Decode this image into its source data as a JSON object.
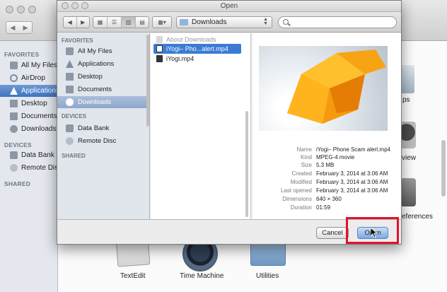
{
  "background": {
    "sidebar": {
      "favorites_header": "FAVORITES",
      "favorites": [
        "All My Files",
        "AirDrop",
        "Applications",
        "Desktop",
        "Documents",
        "Downloads"
      ],
      "selected": "Applications",
      "devices_header": "DEVICES",
      "devices": [
        "Data Bank",
        "Remote Disc"
      ],
      "shared_header": "SHARED"
    },
    "apps": [
      "TextEdit",
      "Time Machine",
      "Utilities"
    ],
    "right_labels": [
      "ps",
      "view",
      "eferences"
    ]
  },
  "dialog": {
    "title": "Open",
    "location": "Downloads",
    "search_placeholder": "",
    "sidebar": {
      "favorites_header": "FAVORITES",
      "favorites": [
        "All My Files",
        "Applications",
        "Desktop",
        "Documents",
        "Downloads"
      ],
      "selected": "Downloads",
      "devices_header": "DEVICES",
      "devices": [
        "Data Bank",
        "Remote Disc"
      ],
      "shared_header": "SHARED"
    },
    "files": [
      {
        "name": "About Downloads",
        "state": "dimmed"
      },
      {
        "name": "iYogi– Pho...alert.mp4",
        "state": "selected"
      },
      {
        "name": "iYogi.mp4",
        "state": "normal"
      }
    ],
    "preview": {
      "metadata": [
        {
          "key": "Name",
          "value": "iYogi– Phone Scam alert.mp4"
        },
        {
          "key": "Kind",
          "value": "MPEG-4 movie"
        },
        {
          "key": "Size",
          "value": "5.3 MB"
        },
        {
          "key": "Created",
          "value": "February 3, 2014 at 3:06 AM"
        },
        {
          "key": "Modified",
          "value": "February 3, 2014 at 3:06 AM"
        },
        {
          "key": "Last opened",
          "value": "February 3, 2014 at 3:06 AM"
        },
        {
          "key": "Dimensions",
          "value": "640 × 360"
        },
        {
          "key": "Duration",
          "value": "01:59"
        }
      ]
    },
    "buttons": {
      "cancel": "Cancel",
      "open": "Open"
    },
    "accent": "#3c7bd4",
    "annotation_color": "#e0132a"
  }
}
